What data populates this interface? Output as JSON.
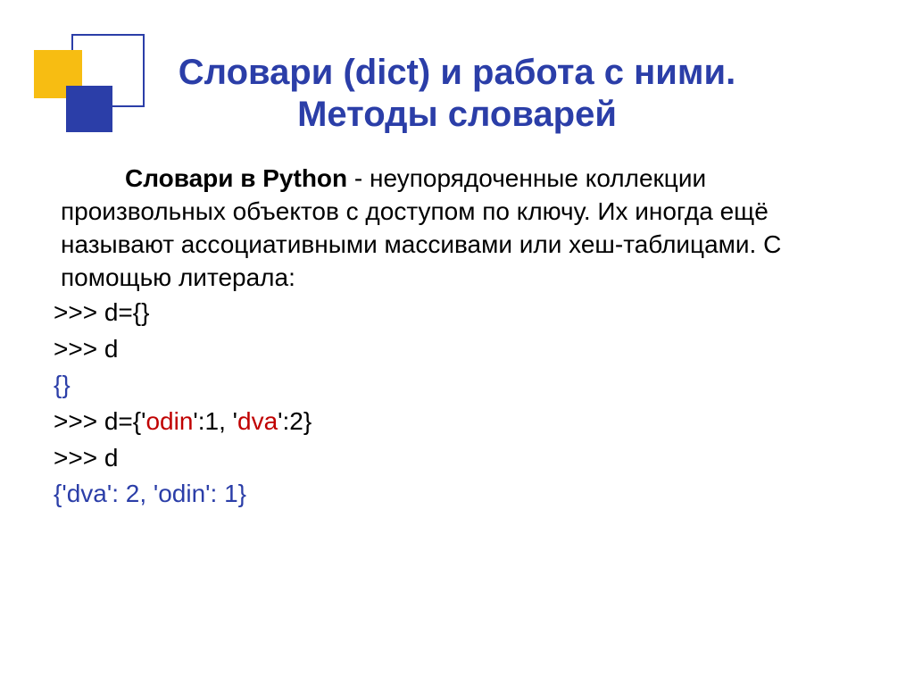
{
  "title": {
    "line1": "Словари (dict) и работа с ними.",
    "line2": "Методы словарей"
  },
  "paragraph": {
    "bold_lead": "Словари в Python",
    "rest": " - неупорядоченные коллекции произвольных объектов с доступом по ключу. Их иногда ещё называют ассоциативными массивами или хеш-таблицами. С помощью литерала:"
  },
  "code": {
    "l1": ">>> d={}",
    "l2": ">>> d",
    "l3": "{}",
    "l4_a": ">>> d={'",
    "l4_b": "odin",
    "l4_c": "':1, '",
    "l4_d": "dva",
    "l4_e": "':2}",
    "l5": ">>> d",
    "l6": "{'dva': 2, 'odin': 1}"
  }
}
